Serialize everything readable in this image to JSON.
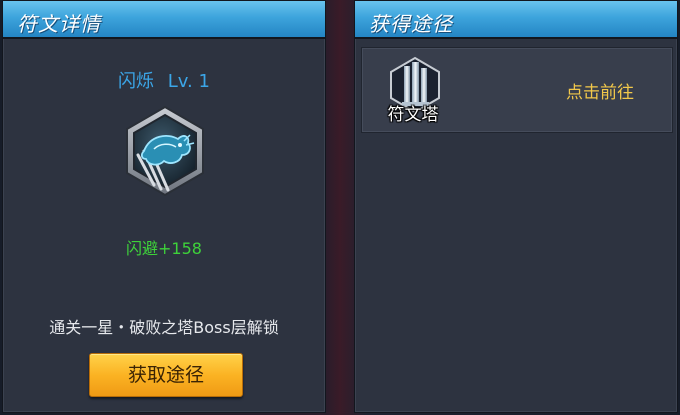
{
  "rune_detail": {
    "header_title": "符文详情",
    "rune_name": "闪烁",
    "rune_level": "Lv. 1",
    "rune_icon": "dragon-emblem-icon",
    "stat_bonus": "闪避+158",
    "unlock_condition": "通关一星・破败之塔Boss层解锁",
    "get_source_button_label": "获取途径"
  },
  "acquire_paths": {
    "header_title": "获得途径",
    "sources": [
      {
        "label": "符文塔",
        "icon": "tower-icon",
        "action_label": "点击前往"
      }
    ]
  },
  "colors": {
    "header_blue": "#3da4dc",
    "rune_name_blue": "#3ba6e8",
    "stat_green": "#3ed23a",
    "action_gold": "#f2c84a",
    "button_orange": "#fbb323"
  }
}
